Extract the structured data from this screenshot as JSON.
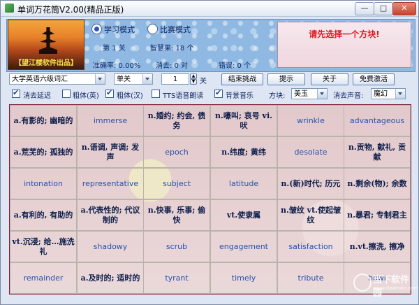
{
  "window": {
    "title": "单词万花筒V2.00(精品正版)"
  },
  "logo": {
    "label": "【望江楼软件出品】"
  },
  "modes": {
    "study": "学习模式",
    "compete": "比赛模式"
  },
  "stats": {
    "level": "第 1 关",
    "wisdom": "智慧果: 18 个",
    "accuracy": "准确率: 0.00%",
    "cleared": "消去: 0 对",
    "errors": "错误: 0 个"
  },
  "prompt": "请先选择一个方块!",
  "controls": {
    "wordbook": "大学英语六级词汇",
    "level_mode": "单关",
    "level_number": "1",
    "level_suffix": "关",
    "end_challenge": "结束挑战",
    "hint": "提示",
    "about": "关于",
    "free_activate": "免费激活"
  },
  "options": {
    "delay_clear": "消去延迟",
    "bold_en": "粗体(英)",
    "bold_cn": "粗体(汉)",
    "tts": "TTS语音朗读",
    "bg_music": "背景音乐",
    "tile_label": "方块:",
    "tile_value": "美玉",
    "sound_label": "消去声音:",
    "sound_value": "魔幻"
  },
  "grid": [
    [
      "a.有影的; 幽暗的",
      "immerse",
      "n.婚约; 约会, 债务",
      "n.嚎叫; 哀号 vi.吠",
      "wrinkle",
      "advantageous"
    ],
    [
      "a.荒芜的; 孤独的",
      "n.语调, 声调; 发声",
      "epoch",
      "n.纬度; 黄纬",
      "desolate",
      "n.贡物, 献礼, 贡献"
    ],
    [
      "intonation",
      "representative",
      "subject",
      "latitude",
      "n.(新)时代; 历元",
      "n.剩余(物); 余数"
    ],
    [
      "a.有利的, 有助的",
      "a.代表性的; 代议制的",
      "n.快事, 乐事; 偷快",
      "vt.使隶属",
      "n.皱纹 vt.使起皱纹",
      "n.暴君; 专制君主"
    ],
    [
      "vt.沉浸; 给…施洗礼",
      "shadowy",
      "scrub",
      "engagement",
      "satisfaction",
      "n.vt.擦洗, 擦净"
    ],
    [
      "remainder",
      "a.及时的; 适时的",
      "tyrant",
      "timely",
      "tribute",
      "howl"
    ]
  ],
  "grid_types": [
    [
      "def",
      "en",
      "def",
      "def",
      "en",
      "en"
    ],
    [
      "def",
      "def",
      "en",
      "def",
      "en",
      "def"
    ],
    [
      "en",
      "en",
      "en",
      "en",
      "def",
      "def"
    ],
    [
      "def",
      "def",
      "def",
      "def",
      "def",
      "def"
    ],
    [
      "def",
      "en",
      "en",
      "en",
      "en",
      "def"
    ],
    [
      "en",
      "def",
      "en",
      "en",
      "en",
      "en"
    ]
  ],
  "watermark": {
    "name": "当下软件园",
    "url": "www.downxia.com"
  }
}
